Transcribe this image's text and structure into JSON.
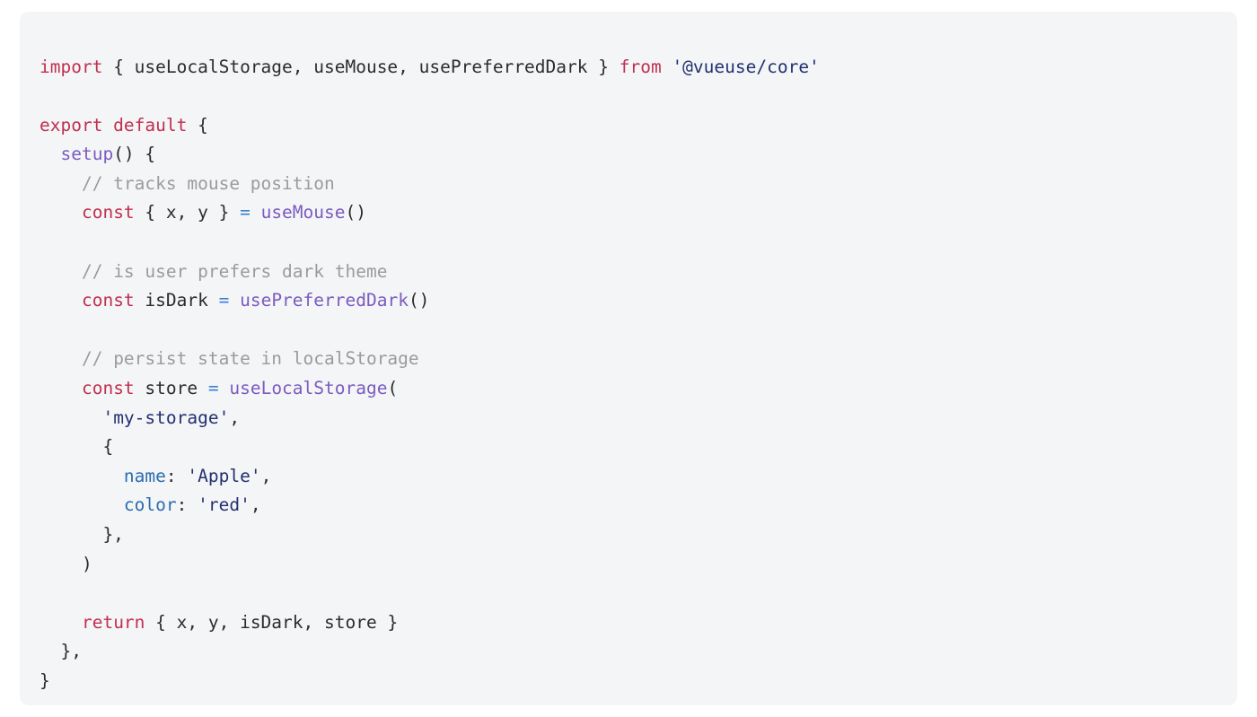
{
  "code_block": {
    "language": "javascript",
    "background_color": "#f4f5f7",
    "page_background_color": "#ffffff",
    "token_colors": {
      "keyword": "#c03050",
      "function": "#7c5bbf",
      "comment": "#9b9b9b",
      "string": "#22316e",
      "property_key": "#2b6cb0",
      "operator": "#3b7fd4",
      "plain": "#2c2c2c"
    },
    "full_text": "import { useLocalStorage, useMouse, usePreferredDark } from '@vueuse/core'\n\nexport default {\n  setup() {\n    // tracks mouse position\n    const { x, y } = useMouse()\n\n    // is user prefers dark theme\n    const isDark = usePreferredDark()\n\n    // persist state in localStorage\n    const store = useLocalStorage(\n      'my-storage',\n      {\n        name: 'Apple',\n        color: 'red',\n      },\n    )\n\n    return { x, y, isDark, store }\n  },\n}",
    "lines": [
      {
        "index": 1,
        "text": "import { useLocalStorage, useMouse, usePreferredDark } from '@vueuse/core'",
        "tokens": [
          {
            "t": "import",
            "c": "keyword"
          },
          {
            "t": " { useLocalStorage, useMouse, usePreferredDark } ",
            "c": "plain"
          },
          {
            "t": "from",
            "c": "keyword"
          },
          {
            "t": " ",
            "c": "plain"
          },
          {
            "t": "'@vueuse/core'",
            "c": "string"
          }
        ]
      },
      {
        "index": 2,
        "text": "",
        "tokens": []
      },
      {
        "index": 3,
        "text": "export default {",
        "tokens": [
          {
            "t": "export default",
            "c": "keyword"
          },
          {
            "t": " {",
            "c": "plain"
          }
        ]
      },
      {
        "index": 4,
        "text": "  setup() {",
        "tokens": [
          {
            "t": "  ",
            "c": "plain"
          },
          {
            "t": "setup",
            "c": "function"
          },
          {
            "t": "() {",
            "c": "plain"
          }
        ]
      },
      {
        "index": 5,
        "text": "    // tracks mouse position",
        "tokens": [
          {
            "t": "    ",
            "c": "plain"
          },
          {
            "t": "// tracks mouse position",
            "c": "comment"
          }
        ]
      },
      {
        "index": 6,
        "text": "    const { x, y } = useMouse()",
        "tokens": [
          {
            "t": "    ",
            "c": "plain"
          },
          {
            "t": "const",
            "c": "keyword"
          },
          {
            "t": " { x, y } ",
            "c": "plain"
          },
          {
            "t": "=",
            "c": "operator"
          },
          {
            "t": " ",
            "c": "plain"
          },
          {
            "t": "useMouse",
            "c": "function"
          },
          {
            "t": "()",
            "c": "plain"
          }
        ]
      },
      {
        "index": 7,
        "text": "",
        "tokens": []
      },
      {
        "index": 8,
        "text": "    // is user prefers dark theme",
        "tokens": [
          {
            "t": "    ",
            "c": "plain"
          },
          {
            "t": "// is user prefers dark theme",
            "c": "comment"
          }
        ]
      },
      {
        "index": 9,
        "text": "    const isDark = usePreferredDark()",
        "tokens": [
          {
            "t": "    ",
            "c": "plain"
          },
          {
            "t": "const",
            "c": "keyword"
          },
          {
            "t": " isDark ",
            "c": "plain"
          },
          {
            "t": "=",
            "c": "operator"
          },
          {
            "t": " ",
            "c": "plain"
          },
          {
            "t": "usePreferredDark",
            "c": "function"
          },
          {
            "t": "()",
            "c": "plain"
          }
        ]
      },
      {
        "index": 10,
        "text": "",
        "tokens": []
      },
      {
        "index": 11,
        "text": "    // persist state in localStorage",
        "tokens": [
          {
            "t": "    ",
            "c": "plain"
          },
          {
            "t": "// persist state in localStorage",
            "c": "comment"
          }
        ]
      },
      {
        "index": 12,
        "text": "    const store = useLocalStorage(",
        "tokens": [
          {
            "t": "    ",
            "c": "plain"
          },
          {
            "t": "const",
            "c": "keyword"
          },
          {
            "t": " store ",
            "c": "plain"
          },
          {
            "t": "=",
            "c": "operator"
          },
          {
            "t": " ",
            "c": "plain"
          },
          {
            "t": "useLocalStorage",
            "c": "function"
          },
          {
            "t": "(",
            "c": "plain"
          }
        ]
      },
      {
        "index": 13,
        "text": "      'my-storage',",
        "tokens": [
          {
            "t": "      ",
            "c": "plain"
          },
          {
            "t": "'my-storage'",
            "c": "string"
          },
          {
            "t": ",",
            "c": "plain"
          }
        ]
      },
      {
        "index": 14,
        "text": "      {",
        "tokens": [
          {
            "t": "      {",
            "c": "plain"
          }
        ]
      },
      {
        "index": 15,
        "text": "        name: 'Apple',",
        "tokens": [
          {
            "t": "        ",
            "c": "plain"
          },
          {
            "t": "name",
            "c": "property_key"
          },
          {
            "t": ": ",
            "c": "plain"
          },
          {
            "t": "'Apple'",
            "c": "string"
          },
          {
            "t": ",",
            "c": "plain"
          }
        ]
      },
      {
        "index": 16,
        "text": "        color: 'red',",
        "tokens": [
          {
            "t": "        ",
            "c": "plain"
          },
          {
            "t": "color",
            "c": "property_key"
          },
          {
            "t": ": ",
            "c": "plain"
          },
          {
            "t": "'red'",
            "c": "string"
          },
          {
            "t": ",",
            "c": "plain"
          }
        ]
      },
      {
        "index": 17,
        "text": "      },",
        "tokens": [
          {
            "t": "      },",
            "c": "plain"
          }
        ]
      },
      {
        "index": 18,
        "text": "    )",
        "tokens": [
          {
            "t": "    )",
            "c": "plain"
          }
        ]
      },
      {
        "index": 19,
        "text": "",
        "tokens": []
      },
      {
        "index": 20,
        "text": "    return { x, y, isDark, store }",
        "tokens": [
          {
            "t": "    ",
            "c": "plain"
          },
          {
            "t": "return",
            "c": "keyword"
          },
          {
            "t": " { x, y, isDark, store }",
            "c": "plain"
          }
        ]
      },
      {
        "index": 21,
        "text": "  },",
        "tokens": [
          {
            "t": "  },",
            "c": "plain"
          }
        ]
      },
      {
        "index": 22,
        "text": "}",
        "tokens": [
          {
            "t": "}",
            "c": "plain"
          }
        ]
      }
    ]
  }
}
